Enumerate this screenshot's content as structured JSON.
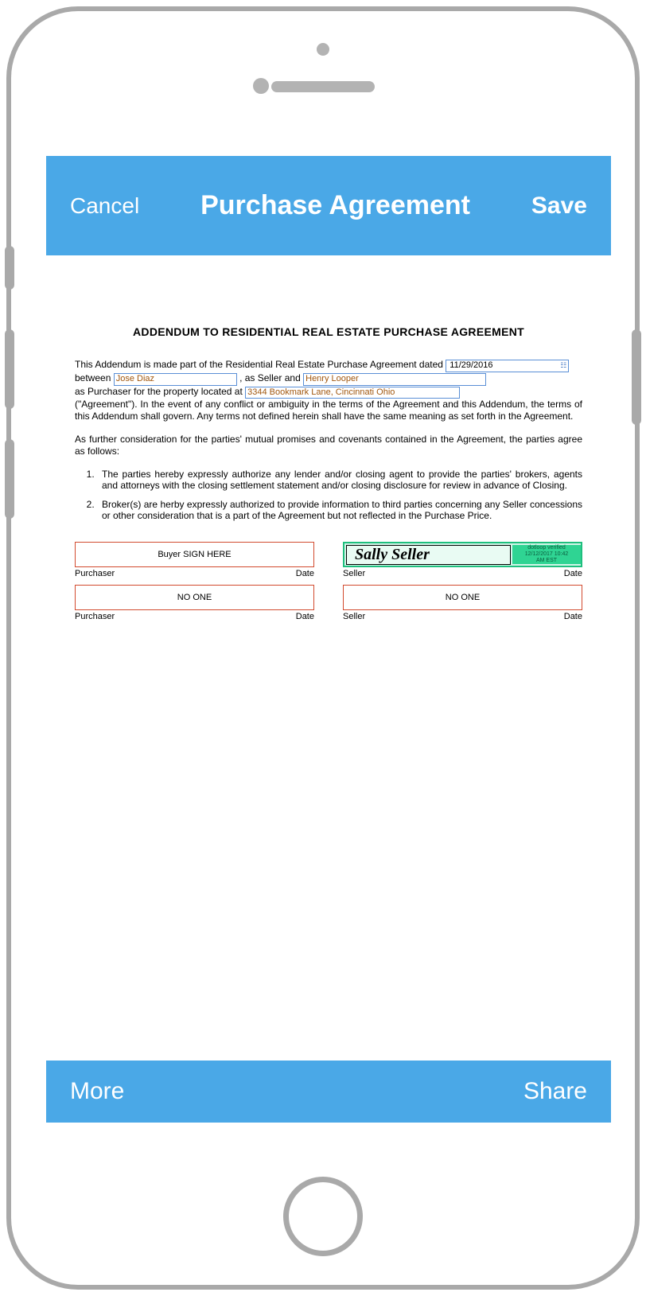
{
  "header": {
    "cancel_label": "Cancel",
    "title": "Purchase Agreement",
    "save_label": "Save"
  },
  "footer": {
    "more_label": "More",
    "share_label": "Share"
  },
  "document": {
    "heading": "ADDENDUM TO RESIDENTIAL REAL ESTATE PURCHASE AGREEMENT",
    "intro_part1": "This Addendum is made part of the Residential Real Estate Purchase Agreement dated",
    "date_value": "11/29/2016",
    "intro_part2": "between",
    "seller_name": "Jose Diaz",
    "intro_part3": ", as Seller and",
    "buyer_name": "Henry Looper",
    "intro_part4": "as Purchaser for the property located at",
    "property_address": "3344 Bookmark Lane, Cincinnati Ohio",
    "intro_tail": "(\"Agreement\").  In the event of any conflict or ambiguity in the terms of the Agreement and this Addendum, the terms of this Addendum shall govern.  Any terms not defined herein shall have the same meaning as set forth in the Agreement.",
    "para2": "As further consideration for the parties' mutual promises and covenants contained in the Agreement, the parties agree as follows:",
    "items": [
      "The parties hereby expressly authorize any lender and/or closing agent to provide the parties' brokers, agents and attorneys with the closing settlement statement and/or closing disclosure for review in advance of Closing.",
      "Broker(s) are herby expressly authorized to provide information to third parties concerning any Seller concessions or other consideration that is a part of the Agreement but not reflected in the Purchase Price."
    ],
    "signatures": {
      "row1": {
        "buyer_box_label_empty": "Buyer SIGN HERE",
        "seller_signature_name": "Sally Seller",
        "stamp_line1": "dotloop verified",
        "stamp_line2": "12/12/2017 10:42",
        "stamp_line3": "AM EST",
        "purchaser_label": "Purchaser",
        "date_label": "Date",
        "seller_label": "Seller"
      },
      "row2": {
        "noone_label": "NO ONE",
        "purchaser_label": "Purchaser",
        "date_label": "Date",
        "seller_label": "Seller"
      }
    }
  }
}
